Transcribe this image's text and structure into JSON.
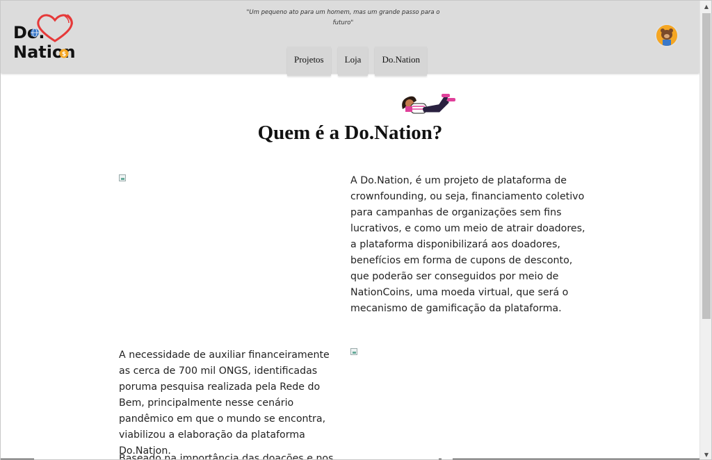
{
  "header": {
    "logo": {
      "line1": "Do.",
      "line2": "Nation"
    },
    "quote": "\"Um pequeno ato para um homem, mas um grande passo para o futuro\"",
    "nav": [
      {
        "label": "Projetos"
      },
      {
        "label": "Loja"
      },
      {
        "label": "Do.Nation"
      }
    ]
  },
  "main": {
    "title": "Quem é a Do.Nation?",
    "paragraphs": [
      "A Do.Nation, é um projeto de plataforma de crownfounding, ou seja, financiamento coletivo para campanhas de organizações sem fins lucrativos, e como um meio de atrair doadores, a plataforma disponibilizará aos doadores, benefícios em forma de cupons de desconto, que poderão ser conseguidos por meio de NationCoins, uma moeda virtual, que será o mecanismo de gamificação da plataforma.",
      "A necessidade de auxiliar financeiramente as cerca de 700 mil ONGS, identificadas poruma pesquisa realizada pela Rede do Bem, principalmente nesse cenário pandêmico em que o mundo se encontra, viabilizou a elaboração da plataforma Do.Nation.",
      "Baseado na importância das doações e nos"
    ]
  },
  "colors": {
    "header_bg": "#dcdcdc",
    "heart": "#e63939",
    "coin": "#f5a623",
    "accent_pink": "#e0409a"
  },
  "icons": [
    "heart-logo-icon",
    "globe-icon",
    "coin-icon",
    "user-avatar-icon",
    "scroll-up-arrow-icon",
    "scroll-down-arrow-icon"
  ]
}
